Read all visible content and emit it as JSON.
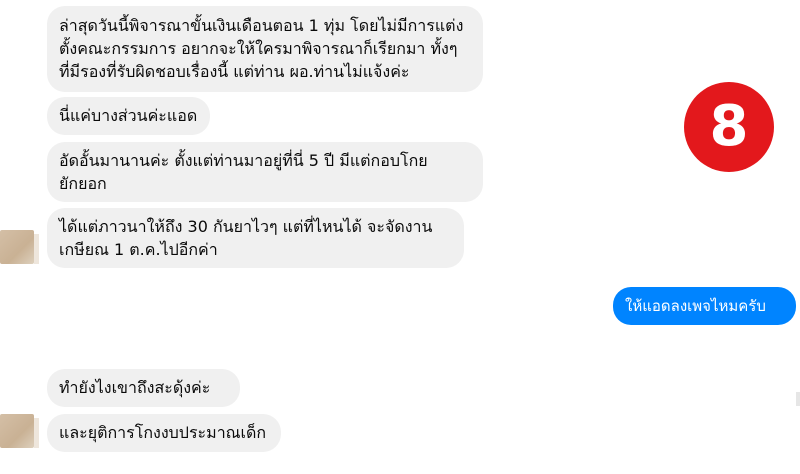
{
  "badge": {
    "number": "8"
  },
  "messages": {
    "m1": "ล่าสุดวันนี้พิจารณาขั้นเงินเดือนตอน 1 ทุ่ม โดยไม่มีการแต่ง\nตั้งคณะกรรมการ อยากจะให้ใครมาพิจารณาก็เรียกมา ทั้งๆ\nที่มีรองที่รับผิดชอบเรื่องนี้ แต่ท่าน ผอ.ท่านไม่แจ้งค่ะ",
    "m2": "นี่แค่บางส่วนค่ะแอด",
    "m3": "อัดอั้นมานานค่ะ ตั้งแต่ท่านมาอยู่ที่นี่ 5 ปี มีแต่กอบโกย\nยักยอก",
    "m4": "ได้แต่ภาวนาให้ถึง 30 กันยาไวๆ แต่ที่ไหนได้ จะจัดงาน\nเกษียณ 1 ต.ค.ไปอีกค่า",
    "m5_outgoing": "ให้แอดลงเพจไหมครับ",
    "m6": "ทำยังไงเขาถึงสะดุ้งค่ะ",
    "m7": "และยุติการโกงงบประมาณเด็ก"
  },
  "colors": {
    "incoming_bubble": "#f0f0f0",
    "outgoing_bubble": "#0084ff",
    "badge": "#e3181c"
  }
}
